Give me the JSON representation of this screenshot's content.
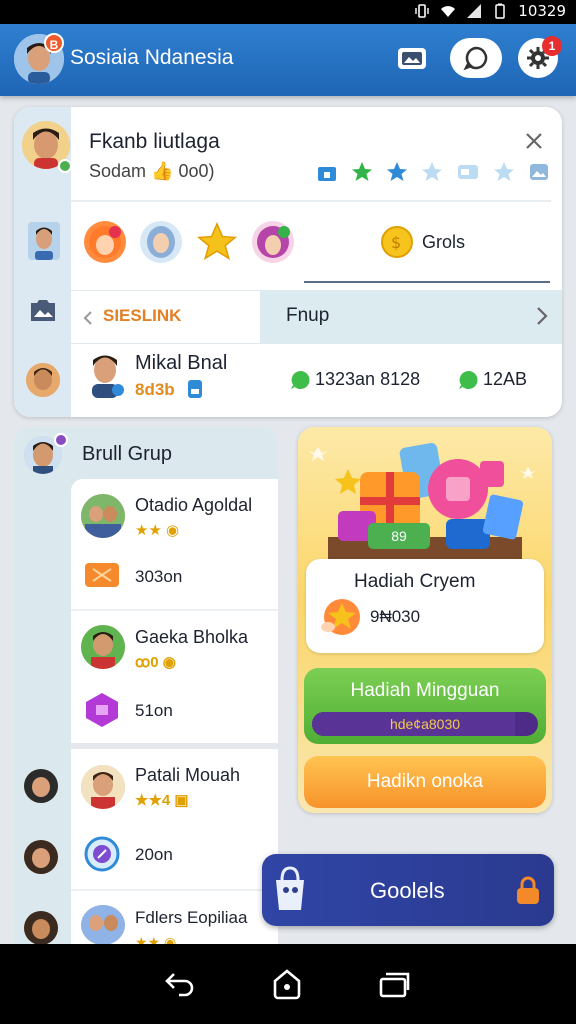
{
  "status_bar": {
    "time": "10329"
  },
  "app_bar": {
    "title": "Sosiaia Ndanesia",
    "avatar_badge": "B",
    "notification_count": "1",
    "accent": "#2a74c6"
  },
  "rank_card": {
    "name": "Fkanb liutlaga",
    "subtitle": "Sodam 👍 0o0)",
    "badge_label": "Grols",
    "tabs": [
      {
        "label": "SIESLINK",
        "active": true
      },
      {
        "label": "Fnup",
        "active": false
      }
    ],
    "member": {
      "name": "Mikal Bnal",
      "meta": "8d3b",
      "stat_1": "1323an 8128",
      "stat_2": "12AB"
    }
  },
  "group_card": {
    "title": "Brull Grup",
    "members": [
      {
        "name": "Otadio Agoldal",
        "value": "303on"
      },
      {
        "name": "Gaeka Bholka",
        "value": "51on"
      },
      {
        "name": "Patali Mouah",
        "value": "20on"
      },
      {
        "name": "Fdlers Eopiliaa",
        "value": ""
      }
    ]
  },
  "promo": {
    "tag": "89",
    "title": "Hadiah Cryem",
    "amount": "9₦030",
    "weekly_label": "Hadiah Mingguan",
    "weekly_progress_text": "hde¢a8030",
    "weekly_progress": 0.9,
    "claim_label": "Hadikn onoka"
  },
  "fab": {
    "label": "Goolels"
  }
}
